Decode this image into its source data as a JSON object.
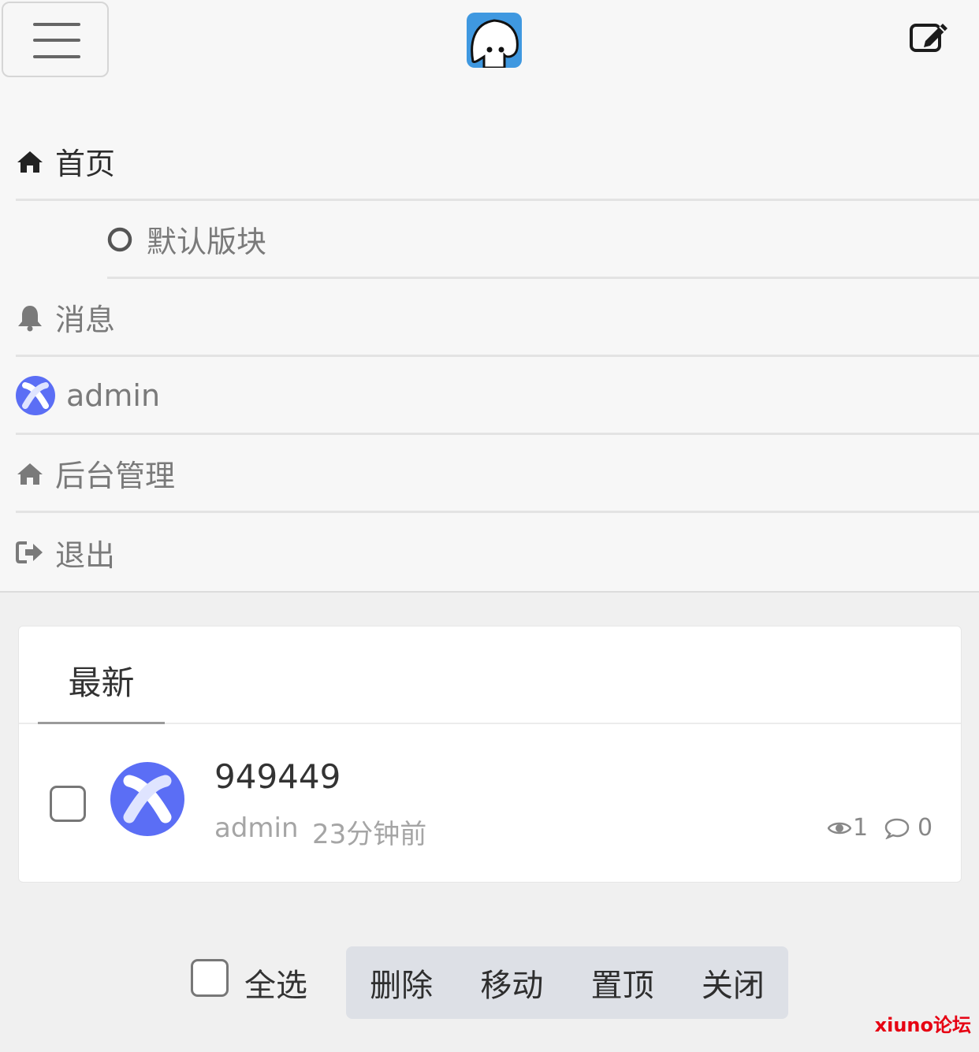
{
  "nav": {
    "items": [
      {
        "label": "首页",
        "icon": "home-icon"
      },
      {
        "label": "默认版块",
        "icon": "circle-icon"
      },
      {
        "label": "消息",
        "icon": "bell-icon"
      },
      {
        "label": "admin",
        "icon": "user-avatar"
      },
      {
        "label": "后台管理",
        "icon": "home-icon"
      },
      {
        "label": "退出",
        "icon": "sign-out-icon"
      }
    ]
  },
  "tabs": {
    "latest": "最新"
  },
  "threads": [
    {
      "subject": "949449",
      "author": "admin",
      "time": "23分钟前",
      "views": "1",
      "replies": "0"
    }
  ],
  "bulk": {
    "select_all": "全选",
    "delete": "删除",
    "move": "移动",
    "top": "置顶",
    "close": "关闭"
  },
  "watermark": "xiuno论坛",
  "colors": {
    "accent": "#5b6ef5",
    "logo_bg": "#3f98e0",
    "watermark": "#e60012",
    "btn_group_bg": "#dde0e6"
  }
}
